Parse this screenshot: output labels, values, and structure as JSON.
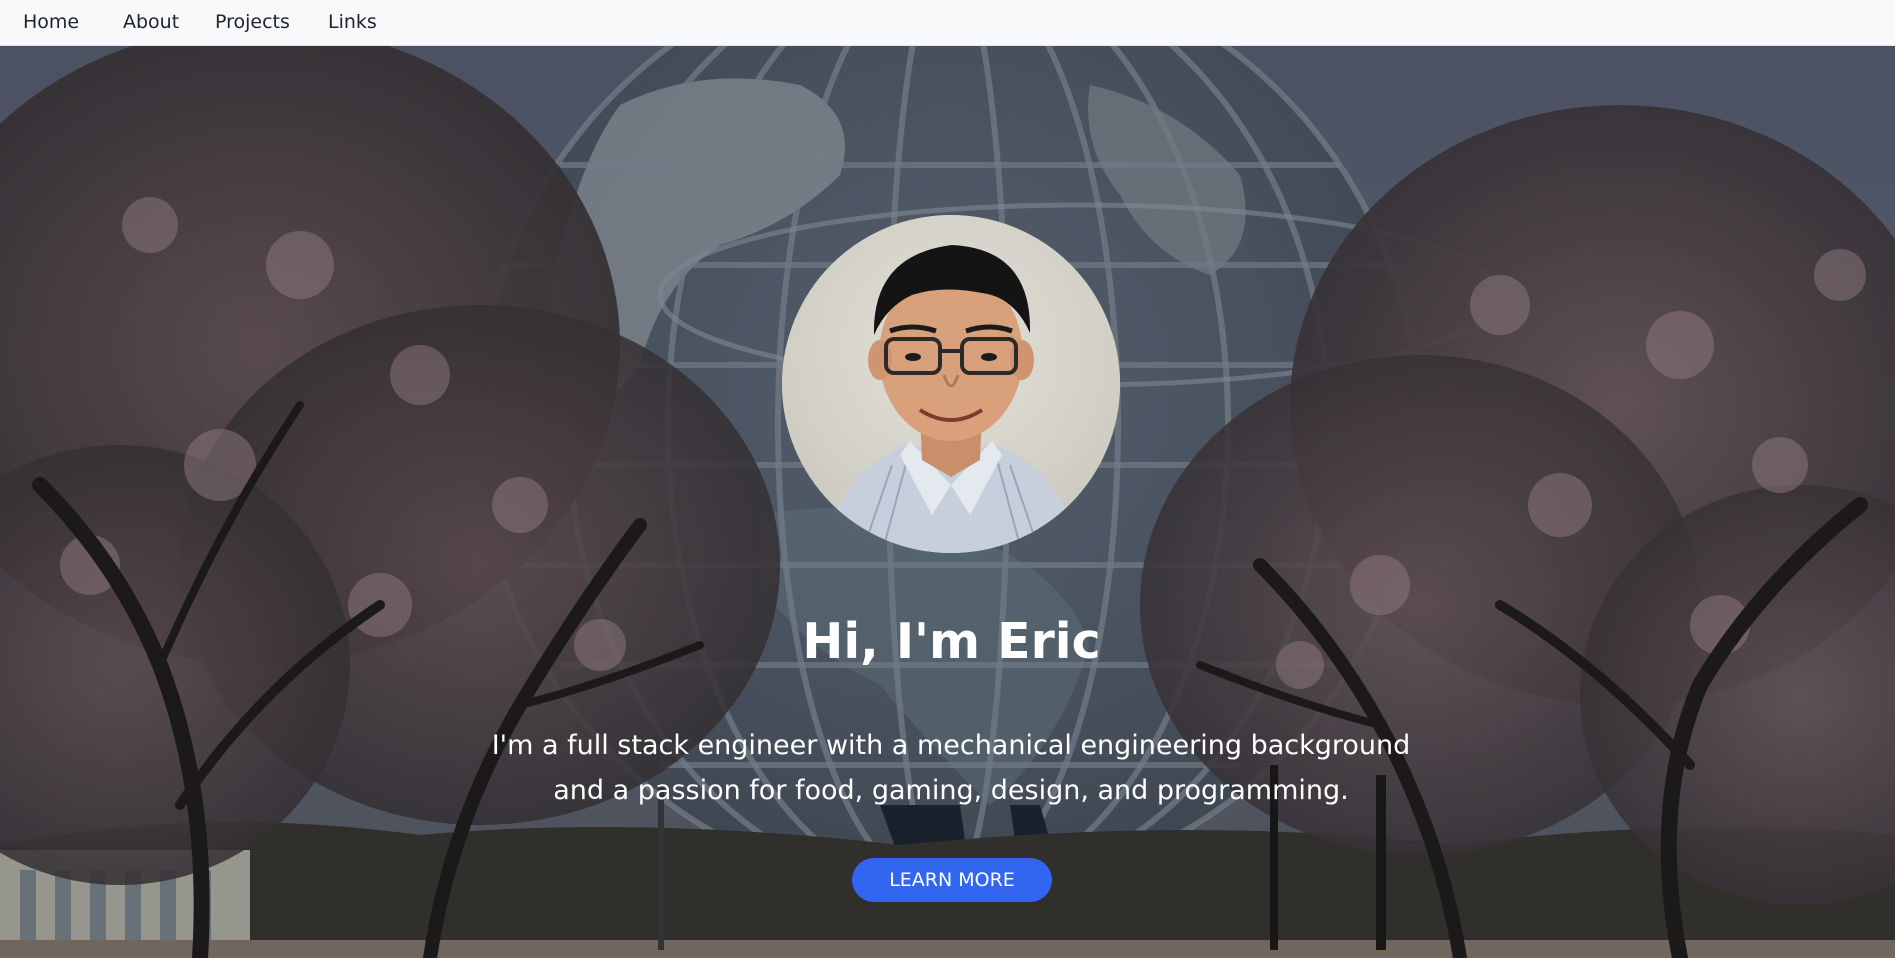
{
  "nav": {
    "items": [
      {
        "label": "Home"
      },
      {
        "label": "About"
      },
      {
        "label": "Projects"
      },
      {
        "label": "Links"
      }
    ]
  },
  "hero": {
    "title": "Hi, I'm Eric",
    "description_lines": [
      "I'm a full stack engineer with a mechanical engineering background",
      "and a passion for food, gaming, design, and programming."
    ],
    "cta_label": "LEARN MORE"
  },
  "colors": {
    "navbar_bg": "#f8f9fa",
    "nav_text": "#212529",
    "hero_text": "#ffffff",
    "cta_bg": "#3366f0"
  }
}
